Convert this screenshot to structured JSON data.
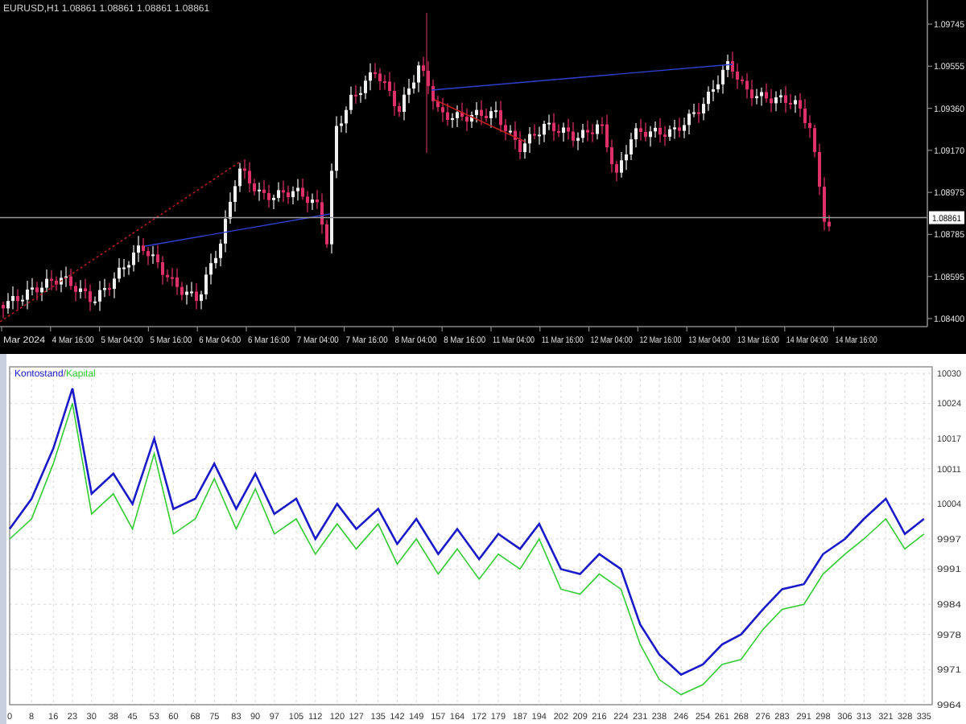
{
  "price_chart": {
    "header": "EURUSD,H1  1.08861 1.08861 1.08861 1.08861",
    "price_ticks": [
      "1.09745",
      "1.09555",
      "1.09360",
      "1.09170",
      "1.08975",
      "1.08785",
      "1.08595",
      "1.08400"
    ],
    "current_price": "1.08861",
    "time_labels": [
      "Mar 2024",
      "4 Mar 16:00",
      "5 Mar 04:00",
      "5 Mar 16:00",
      "6 Mar 04:00",
      "6 Mar 16:00",
      "7 Mar 04:00",
      "7 Mar 16:00",
      "8 Mar 04:00",
      "8 Mar 16:00",
      "11 Mar 04:00",
      "11 Mar 16:00",
      "12 Mar 04:00",
      "12 Mar 16:00",
      "13 Mar 04:00",
      "13 Mar 16:00",
      "14 Mar 04:00",
      "14 Mar 16:00"
    ]
  },
  "balance_chart": {
    "legend_separator": "/",
    "chart_data": {
      "type": "line",
      "x": [
        0,
        8,
        16,
        23,
        30,
        38,
        45,
        53,
        60,
        68,
        75,
        83,
        90,
        97,
        105,
        112,
        120,
        127,
        135,
        142,
        149,
        157,
        164,
        172,
        179,
        187,
        194,
        202,
        209,
        216,
        224,
        231,
        238,
        246,
        254,
        261,
        268,
        276,
        283,
        291,
        298,
        306,
        313,
        321,
        328,
        335
      ],
      "series": [
        {
          "name": "Kontostand",
          "color": "#1a1ac8",
          "values": [
            9999,
            10005,
            10015,
            10027,
            10006,
            10010,
            10004,
            10017,
            10003,
            10005,
            10012,
            10003,
            10010,
            10002,
            10005,
            9997,
            10004,
            9999,
            10003,
            9996,
            10001,
            9994,
            9999,
            9993,
            9998,
            9995,
            10000,
            9991,
            9990,
            9994,
            9991,
            9980,
            9974,
            9970,
            9972,
            9976,
            9978,
            9983,
            9987,
            9988,
            9994,
            9997,
            10001,
            10005,
            9998,
            10001
          ]
        },
        {
          "name": "Kapital",
          "color": "#33cc33",
          "values": [
            9997,
            10001,
            10012,
            10024,
            10002,
            10006,
            9999,
            10014,
            9998,
            10001,
            10009,
            9999,
            10007,
            9998,
            10001,
            9994,
            10000,
            9995,
            10000,
            9992,
            9997,
            9990,
            9995,
            9989,
            9994,
            9991,
            9997,
            9987,
            9986,
            9990,
            9987,
            9976,
            9969,
            9966,
            9968,
            9972,
            9973,
            9979,
            9983,
            9984,
            9990,
            9994,
            9997,
            10001,
            9995,
            9998
          ]
        }
      ],
      "xticks": [
        0,
        8,
        16,
        23,
        30,
        38,
        45,
        53,
        60,
        68,
        75,
        83,
        90,
        97,
        105,
        112,
        120,
        127,
        135,
        142,
        149,
        157,
        164,
        172,
        179,
        187,
        194,
        202,
        209,
        216,
        224,
        231,
        238,
        246,
        254,
        261,
        268,
        276,
        283,
        291,
        298,
        306,
        313,
        321,
        328,
        335
      ],
      "yticks": [
        10030,
        10024,
        10017,
        10011,
        10004,
        9997,
        9991,
        9984,
        9978,
        9971,
        9964
      ],
      "ylim": [
        9964,
        10030
      ],
      "xlim": [
        0,
        338
      ],
      "grid": true
    }
  }
}
